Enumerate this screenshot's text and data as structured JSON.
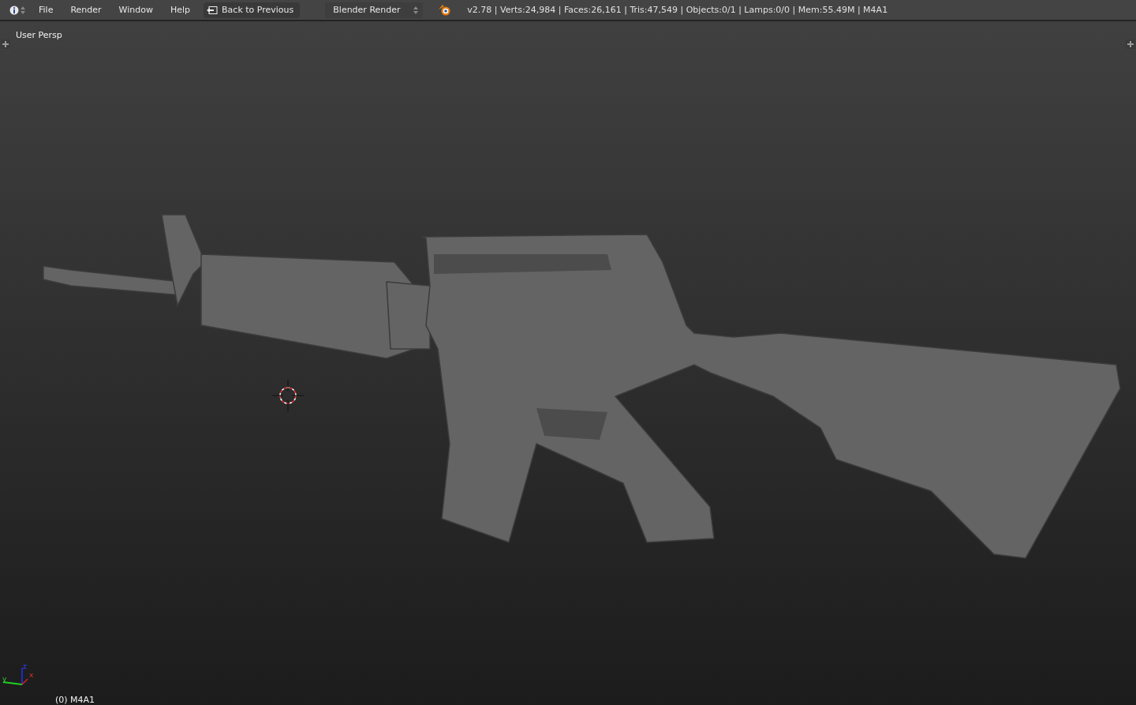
{
  "header": {
    "menus": [
      {
        "label": "File"
      },
      {
        "label": "Render"
      },
      {
        "label": "Window"
      },
      {
        "label": "Help"
      }
    ],
    "back_button": "Back to Previous",
    "render_engine": "Blender Render",
    "stats": "v2.78 | Verts:24,984 | Faces:26,161 | Tris:47,549 | Objects:0/1 | Lamps:0/0 | Mem:55.49M | M4A1"
  },
  "viewport": {
    "view_label": "User Persp",
    "object_label": "(0) M4A1",
    "axes": {
      "x": "x",
      "y": "y",
      "z": "z"
    }
  }
}
